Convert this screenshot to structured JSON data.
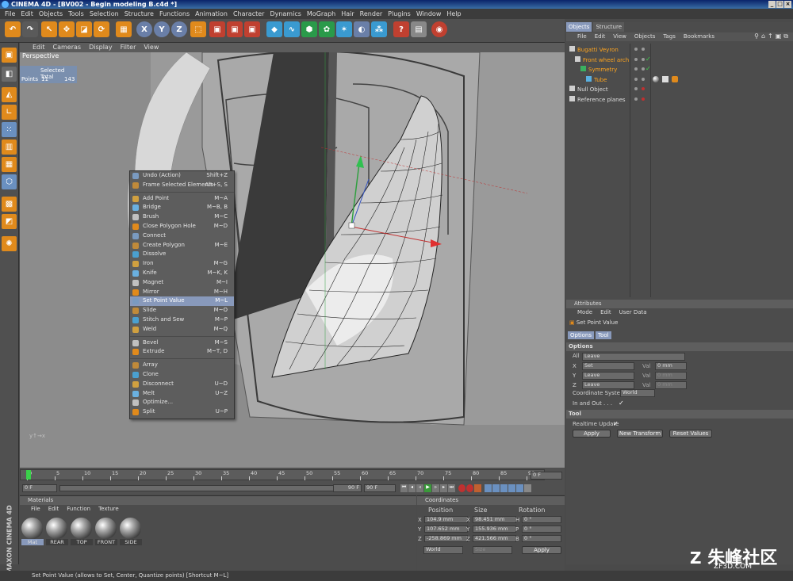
{
  "window": {
    "title": "CINEMA 4D - [BV002 - Begin modeling B.c4d *]",
    "controls": [
      "_",
      "□",
      "×"
    ]
  },
  "menu": [
    "File",
    "Edit",
    "Objects",
    "Tools",
    "Selection",
    "Structure",
    "Functions",
    "Animation",
    "Character",
    "Dynamics",
    "MoGraph",
    "Hair",
    "Render",
    "Plugins",
    "Window",
    "Help"
  ],
  "viewport": {
    "menu": [
      "Edit",
      "Cameras",
      "Display",
      "Filter",
      "View"
    ],
    "label": "Perspective",
    "sel_header": "Selected Total",
    "sel_row_label": "Points",
    "sel_selected": "11",
    "sel_total": "143"
  },
  "context_menu": [
    {
      "label": "Undo (Action)",
      "shortcut": "Shift+Z"
    },
    {
      "label": "Frame Selected Elements",
      "shortcut": "Alt+S, S"
    },
    {
      "sep": true
    },
    {
      "label": "Add Point",
      "shortcut": "M~A"
    },
    {
      "label": "Bridge",
      "shortcut": "M~B, B"
    },
    {
      "label": "Brush",
      "shortcut": "M~C"
    },
    {
      "label": "Close Polygon Hole",
      "shortcut": "M~D"
    },
    {
      "label": "Connect",
      "shortcut": ""
    },
    {
      "label": "Create Polygon",
      "shortcut": "M~E"
    },
    {
      "label": "Dissolve",
      "shortcut": ""
    },
    {
      "label": "Iron",
      "shortcut": "M~G"
    },
    {
      "label": "Knife",
      "shortcut": "M~K, K"
    },
    {
      "label": "Magnet",
      "shortcut": "M~I"
    },
    {
      "label": "Mirror",
      "shortcut": "M~H"
    },
    {
      "label": "Set Point Value",
      "shortcut": "M~L",
      "selected": true
    },
    {
      "label": "Slide",
      "shortcut": "M~O"
    },
    {
      "label": "Stitch and Sew",
      "shortcut": "M~P"
    },
    {
      "label": "Weld",
      "shortcut": "M~Q"
    },
    {
      "sep": true
    },
    {
      "label": "Bevel",
      "shortcut": "M~S"
    },
    {
      "label": "Extrude",
      "shortcut": "M~T, D"
    },
    {
      "sep": true
    },
    {
      "label": "Array",
      "shortcut": ""
    },
    {
      "label": "Clone",
      "shortcut": ""
    },
    {
      "label": "Disconnect",
      "shortcut": "U~D"
    },
    {
      "label": "Melt",
      "shortcut": "U~Z"
    },
    {
      "label": "Optimize...",
      "shortcut": ""
    },
    {
      "label": "Split",
      "shortcut": "U~P"
    }
  ],
  "timeline": {
    "ticks": [
      "0",
      "5",
      "10",
      "15",
      "20",
      "25",
      "30",
      "35",
      "40",
      "45",
      "50",
      "55",
      "60",
      "65",
      "70",
      "75",
      "80",
      "85",
      "90"
    ],
    "current": "0 F",
    "start": "0 F",
    "end": "90 F",
    "max": "90 F"
  },
  "materials": {
    "title": "Materials",
    "menu": [
      "File",
      "Edit",
      "Function",
      "Texture"
    ],
    "items": [
      "Mat",
      "REAR",
      "TOP",
      "FRONT",
      "SIDE"
    ]
  },
  "coordinates": {
    "title": "Coordinates",
    "headers": [
      "Position",
      "Size",
      "Rotation"
    ],
    "rows": [
      {
        "axis": "X",
        "pos": "104.9 mm",
        "size": "98.451 mm",
        "rot_axis": "H",
        "rot": "0 °"
      },
      {
        "axis": "Y",
        "pos": "107.652 mm",
        "size": "155.936 mm",
        "rot_axis": "P",
        "rot": "0 °"
      },
      {
        "axis": "Z",
        "pos": "-258.869 mm",
        "size": "421.566 mm",
        "rot_axis": "B",
        "rot": "0 °"
      }
    ],
    "mode": "World",
    "size_mode": "Size",
    "apply": "Apply"
  },
  "objects": {
    "tabs": [
      "Objects",
      "Structure"
    ],
    "menu": [
      "File",
      "Edit",
      "View",
      "Objects",
      "Tags",
      "Bookmarks"
    ],
    "items": [
      {
        "name": "Bugatti Veyron",
        "indent": 0,
        "highlight": true
      },
      {
        "name": "Front wheel arch",
        "indent": 1,
        "highlight": true
      },
      {
        "name": "Symmetry",
        "indent": 2,
        "highlight": true
      },
      {
        "name": "Tube",
        "indent": 3,
        "highlight": true
      },
      {
        "name": "Null Object",
        "indent": 0,
        "highlight": false
      },
      {
        "name": "Reference planes",
        "indent": 0,
        "highlight": false
      }
    ]
  },
  "attributes": {
    "title": "Attributes",
    "menu": [
      "Mode",
      "Edit",
      "User Data"
    ],
    "tool_name": "Set Point Value",
    "tabs": [
      "Options",
      "Tool"
    ],
    "section_options": "Options",
    "all_label": "All",
    "all_value": "Leave",
    "axes": [
      {
        "axis": "X",
        "mode": "Set",
        "val_label": "Val",
        "val": "0 mm"
      },
      {
        "axis": "Y",
        "mode": "Leave",
        "val_label": "Val",
        "val": "0 mm"
      },
      {
        "axis": "Z",
        "mode": "Leave",
        "val_label": "Val",
        "val": "0 mm"
      }
    ],
    "coord_label": "Coordinate System",
    "coord_value": "World",
    "inout_label": "In and Out . . .",
    "inout_check": "✓",
    "section_tool": "Tool",
    "realtime_label": "Realtime Update",
    "realtime_check": "✓",
    "buttons": [
      "Apply",
      "New Transform",
      "Reset Values"
    ]
  },
  "status": "Set Point Value (allows to Set, Center, Quantize points) [Shortcut M~L]",
  "brand": "MAXON CINEMA 4D",
  "watermark": {
    "cn": "朱峰社区",
    "url": "ZF3D.COM"
  },
  "colors": {
    "accent": "#e08a1c",
    "selection": "#8899bb",
    "highlight_text": "#ffa51f"
  }
}
